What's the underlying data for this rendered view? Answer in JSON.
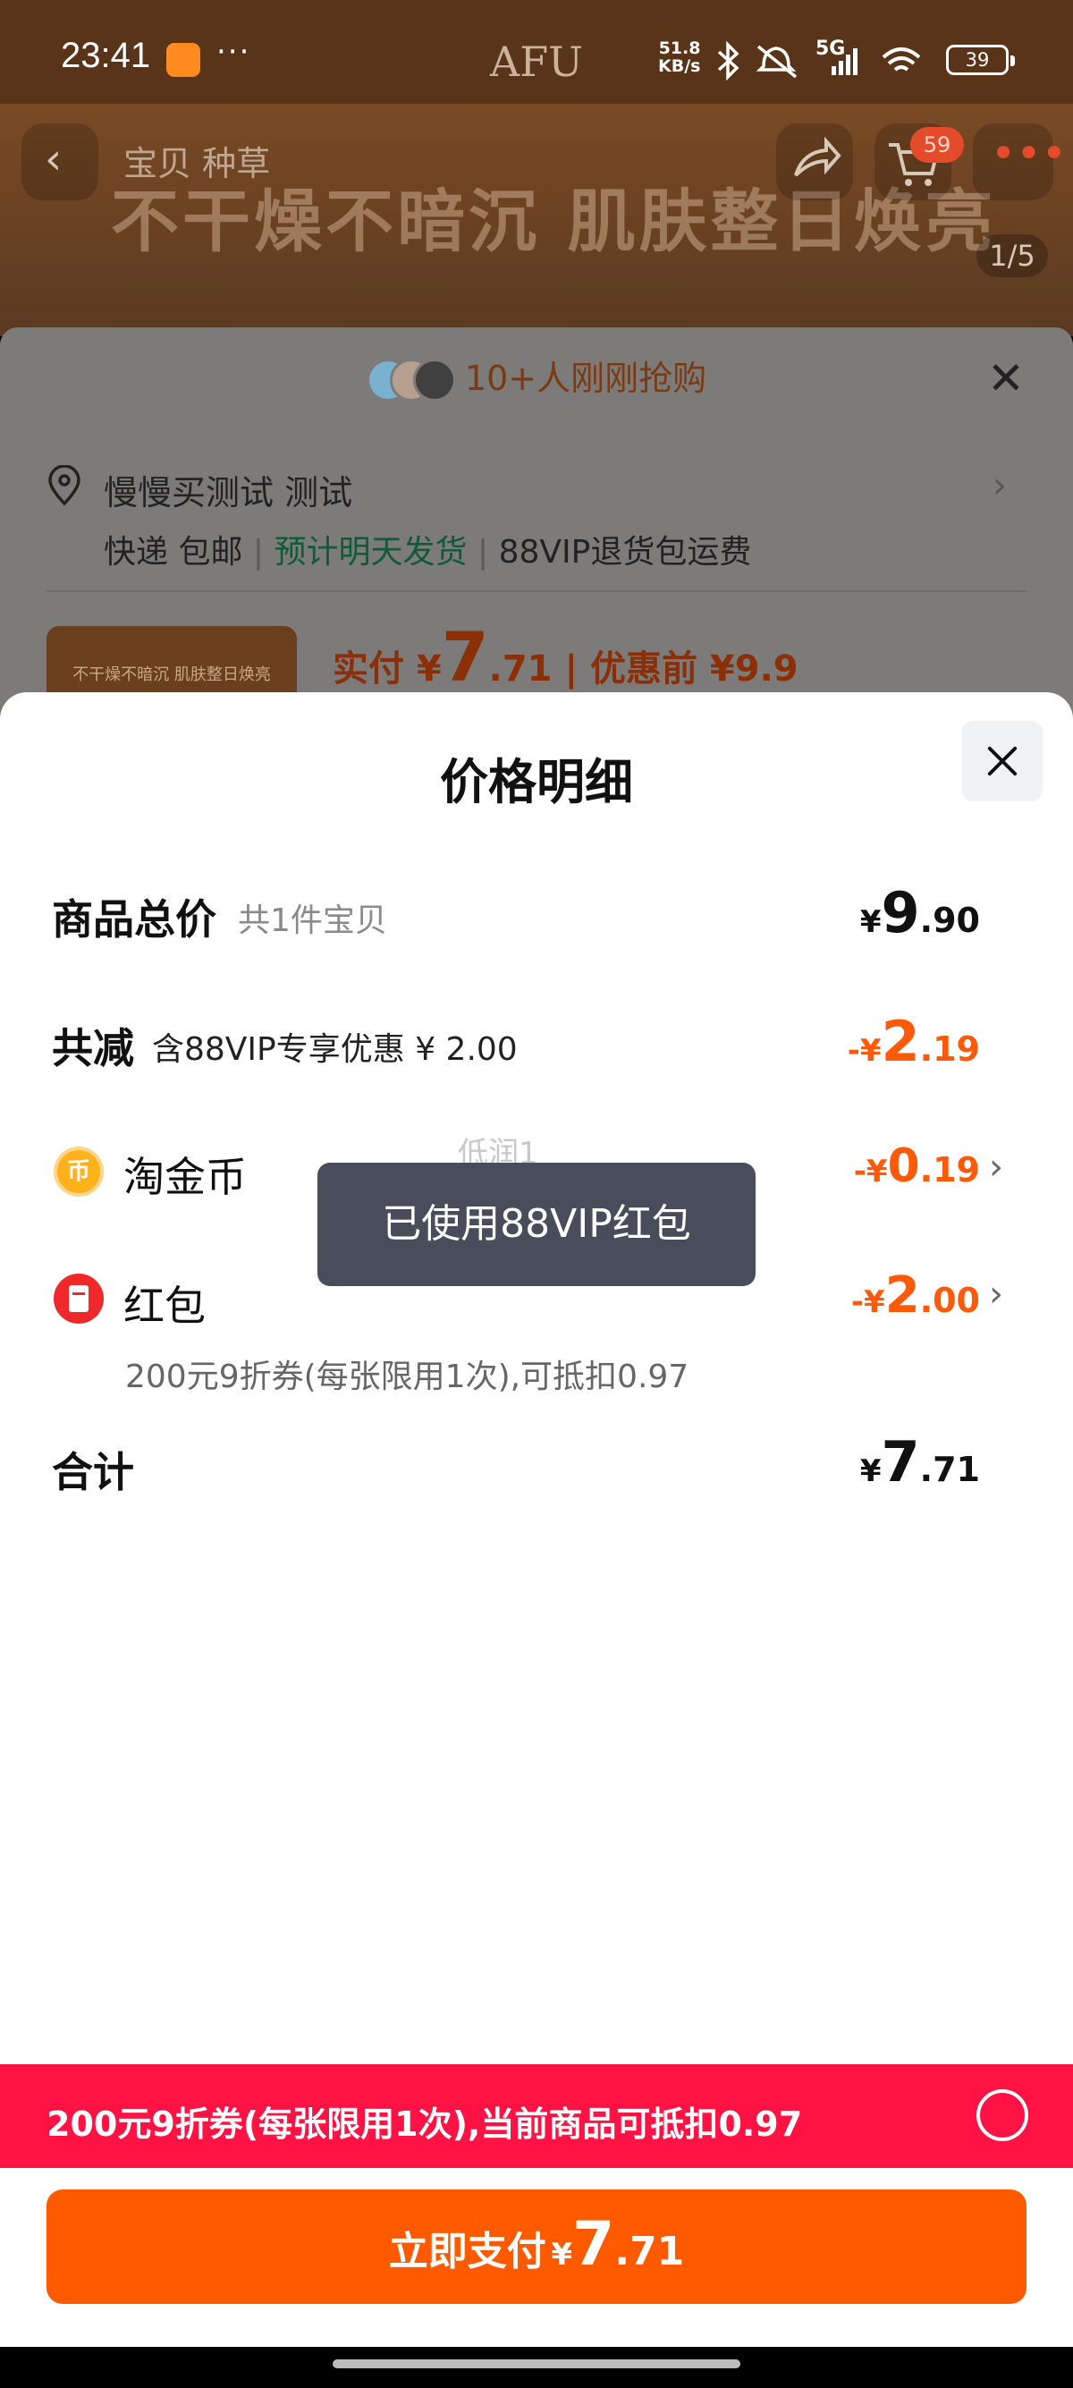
{
  "status_bar": {
    "time": "23:41",
    "dots": "···",
    "logo": "AFU",
    "net_speed_top": "51.8",
    "net_speed_bottom": "KB/s",
    "network": "5G",
    "battery": "39"
  },
  "product_page": {
    "nav_tabs": "宝贝  种草",
    "banner_text": "不干燥不暗沉 肌肤整日焕亮",
    "cart_count": "59",
    "image_index": "1/5",
    "recent_buyers": "10+人刚刚抢购",
    "address_name": "慢慢买测试 测试",
    "shipping": "快递 包邮",
    "ship_time": "预计明天发货",
    "return_note": "88VIP退货包运费",
    "thumb_text": "不干燥不暗沉 肌肤整日焕亮",
    "actual_pay_label": "实付 ¥",
    "actual_pay_int": "7",
    "actual_pay_dec": ".71",
    "before_discount": "| 优惠前 ¥9.9"
  },
  "price_detail": {
    "title": "价格明细",
    "goods_total_label": "商品总价",
    "goods_total_sub": "共1件宝贝",
    "goods_total": {
      "cur": "¥",
      "int": "9",
      "dec": ".90"
    },
    "total_reduce_label": "共减",
    "total_reduce_sub": "含88VIP专享优惠 ¥ 2.00",
    "total_reduce": {
      "cur": "-¥",
      "int": "2",
      "dec": ".19"
    },
    "coin_label": "淘金币",
    "coin_icon_char": "币",
    "coin_amount": {
      "cur": "-¥",
      "int": "0",
      "dec": ".19"
    },
    "ghost_text": "低润1",
    "red_packet_label": "红包",
    "red_packet_amount": {
      "cur": "-¥",
      "int": "2",
      "dec": ".00"
    },
    "red_packet_sub": "200元9折券(每张限用1次),可抵扣0.97",
    "total_label": "合计",
    "total": {
      "cur": "¥",
      "int": "7",
      "dec": ".71"
    }
  },
  "toast": "已使用88VIP红包",
  "coupon_bar": {
    "text": "200元9折券(每张限用1次),当前商品可抵扣0.97"
  },
  "pay_button": {
    "label": "立即支付",
    "cur": "¥",
    "int": "7",
    "dec": ".71"
  },
  "colors": {
    "accent_orange": "#ff5a0a",
    "coupon_red": "#ff1244",
    "pay_button": "#ff5a00",
    "toast_bg": "#494c5a"
  },
  "icons": [
    "back-icon",
    "share-icon",
    "cart-icon",
    "more-icon",
    "close-icon",
    "location-pin-icon",
    "chevron-right-icon",
    "coin-icon",
    "red-packet-icon",
    "radio-icon"
  ]
}
